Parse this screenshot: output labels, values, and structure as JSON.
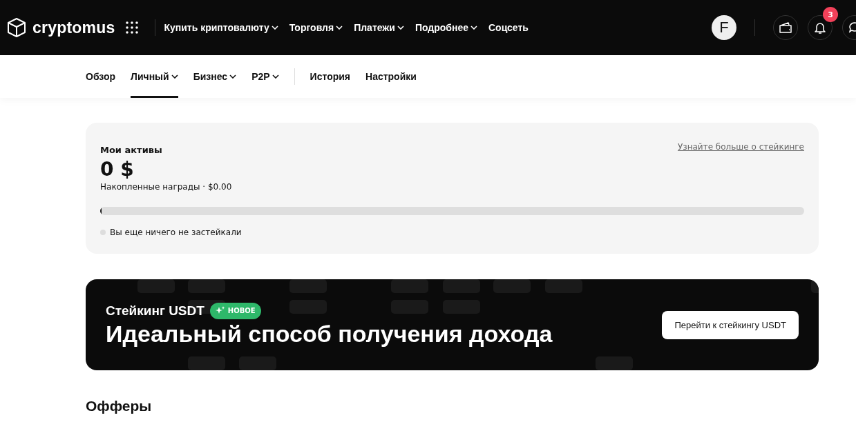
{
  "header": {
    "logo": "cryptomus",
    "nav": [
      {
        "label": "Купить криптовалюту",
        "dropdown": true
      },
      {
        "label": "Торговля",
        "dropdown": true
      },
      {
        "label": "Платежи",
        "dropdown": true
      },
      {
        "label": "Подробнее",
        "dropdown": true
      },
      {
        "label": "Соцсеть",
        "dropdown": false
      }
    ],
    "avatar": "F",
    "notifications": "3"
  },
  "tab_groups": [
    {
      "tabs": [
        {
          "label": "Обзор",
          "dropdown": false,
          "selected": false
        },
        {
          "label": "Личный",
          "dropdown": true,
          "selected": true
        },
        {
          "label": "Бизнес",
          "dropdown": true,
          "selected": false
        },
        {
          "label": "P2P",
          "dropdown": true,
          "selected": false
        }
      ]
    },
    {
      "tabs": [
        {
          "label": "История",
          "dropdown": false,
          "selected": false
        },
        {
          "label": "Настройки",
          "dropdown": false,
          "selected": false
        }
      ]
    }
  ],
  "assets": {
    "title": "Мои активы",
    "link": "Узнайте больше о стейкинге",
    "total": "0 $",
    "rewards": "Накопленные награды · $0.00",
    "level": 0,
    "status": "Вы еще ничего не застейкали"
  },
  "banner": {
    "title": "Стейкинг USDT",
    "badge": "НОВОЕ",
    "headline": "Идеальный способ получения дохода",
    "button": "Перейти к стейкингу USDT"
  },
  "offers_title": "Офферы"
}
